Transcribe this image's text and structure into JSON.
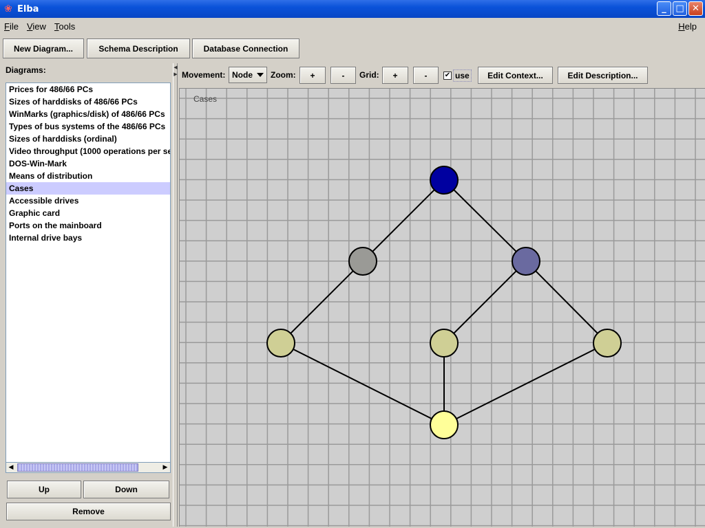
{
  "window": {
    "title": "Elba",
    "minimize": "_",
    "maximize": "□",
    "close": "✕"
  },
  "menu": {
    "file": "File",
    "view": "View",
    "tools": "Tools",
    "help": "Help"
  },
  "toolbar": {
    "new_diagram": "New Diagram...",
    "schema_description": "Schema Description",
    "database_connection": "Database Connection"
  },
  "diagrams": {
    "header": "Diagrams:",
    "items": [
      {
        "label": "Prices for 486/66 PCs",
        "selected": false
      },
      {
        "label": "Sizes of harddisks of 486/66 PCs",
        "selected": false
      },
      {
        "label": "WinMarks (graphics/disk) of 486/66 PCs",
        "selected": false
      },
      {
        "label": "Types of bus systems of the 486/66 PCs",
        "selected": false
      },
      {
        "label": "Sizes of harddisks (ordinal)",
        "selected": false
      },
      {
        "label": "Video throughput (1000 operations per se",
        "selected": false
      },
      {
        "label": "DOS-Win-Mark",
        "selected": false
      },
      {
        "label": "Means of distribution",
        "selected": false
      },
      {
        "label": "Cases",
        "selected": true
      },
      {
        "label": "Accessible drives",
        "selected": false
      },
      {
        "label": "Graphic card",
        "selected": false
      },
      {
        "label": "Ports on the mainboard",
        "selected": false
      },
      {
        "label": "Internal drive bays",
        "selected": false
      }
    ],
    "up": "Up",
    "down": "Down",
    "remove": "Remove"
  },
  "controls": {
    "movement_label": "Movement:",
    "movement_value": "Node",
    "zoom_label": "Zoom:",
    "zoom_plus": "+",
    "zoom_minus": "-",
    "grid_label": "Grid:",
    "grid_plus": "+",
    "grid_minus": "-",
    "use_checked": true,
    "use_label": "use",
    "edit_context": "Edit Context...",
    "edit_description": "Edit Description..."
  },
  "diagram": {
    "title": "Cases",
    "colors": {
      "top": "#0000a0",
      "grey": "#9a9a96",
      "purple": "#6a6aa0",
      "khaki": "#cfcf95",
      "bottom": "#ffff99",
      "grid": "#9a9a9a",
      "background": "#cfcfcf"
    }
  }
}
